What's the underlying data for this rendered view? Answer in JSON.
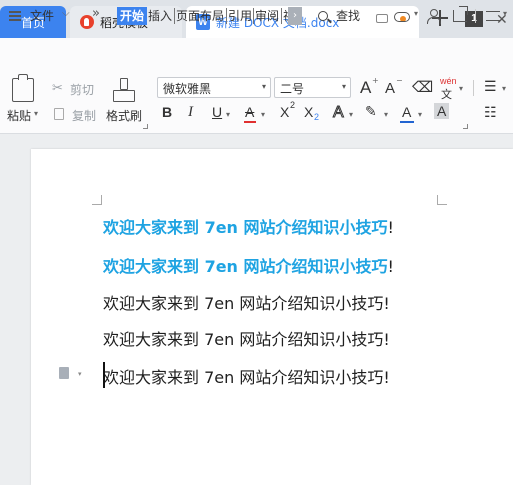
{
  "tabs": {
    "home": "首页",
    "template": "稻壳模板",
    "document": "新建 DOCX 文档.docx",
    "window_count": "1",
    "close": "✕"
  },
  "menu": {
    "file": "文件",
    "more": "»",
    "tabs": [
      "开始",
      "插入",
      "页面布局",
      "引用",
      "审阅",
      "视"
    ],
    "search": "查找"
  },
  "ribbon": {
    "paste": "粘贴",
    "cut": "剪切",
    "copy": "复制",
    "format_painter": "格式刷",
    "font_name": "微软雅黑",
    "font_size": "二号",
    "bold": "B",
    "italic": "I",
    "underline": "U",
    "strikethrough": "A",
    "superscript": "X",
    "superscript_2": "2",
    "subscript": "X",
    "subscript_2": "2",
    "text_effect": "A",
    "phonetic_top": "wén",
    "phonetic_bottom": "文",
    "font_color": "A",
    "shading": "A",
    "grow_font": "A",
    "shrink_font": "A"
  },
  "document": {
    "lines": [
      {
        "text": "欢迎大家来到 7en 网站介绍知识小技巧",
        "suffix": "!",
        "highlight": true
      },
      {
        "text": "欢迎大家来到 7en 网站介绍知识小技巧",
        "suffix": "!",
        "highlight": true
      },
      {
        "text": "欢迎大家来到 7en 网站介绍知识小技巧",
        "suffix": "!",
        "highlight": false
      },
      {
        "text": "欢迎大家来到 7en 网站介绍知识小技巧",
        "suffix": "!",
        "highlight": false
      },
      {
        "text": "欢迎大家来到 7en 网站介绍知识小技巧",
        "suffix": "!",
        "highlight": false
      }
    ]
  },
  "colors": {
    "accent": "#3c83ef",
    "highlight_text": "#1ea3e2",
    "template_brand": "#e8412c"
  }
}
